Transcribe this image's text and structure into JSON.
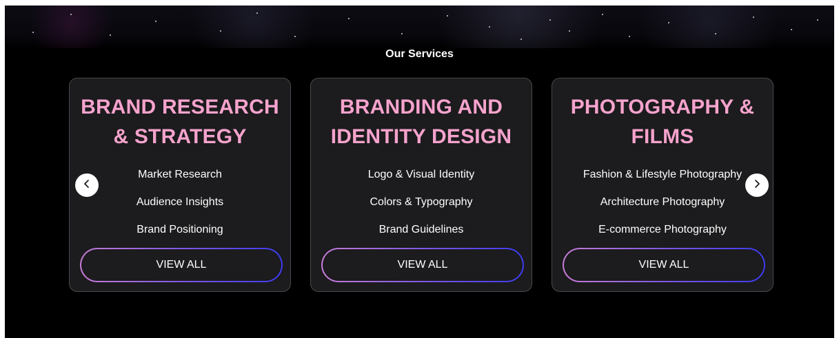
{
  "section": {
    "title": "Our Services"
  },
  "cards": [
    {
      "title_line1": "BRAND RESEARCH",
      "title_line2": "& STRATEGY",
      "items": [
        "Market Research",
        "Audience Insights",
        "Brand Positioning"
      ],
      "button_label": "VIEW ALL"
    },
    {
      "title_line1": "BRANDING AND",
      "title_line2": "IDENTITY DESIGN",
      "items": [
        "Logo & Visual Identity",
        "Colors & Typography",
        "Brand Guidelines"
      ],
      "button_label": "VIEW ALL"
    },
    {
      "title_line1": "PHOTOGRAPHY &",
      "title_line2": "FILMS",
      "items": [
        "Fashion & Lifestyle Photography",
        "Architecture Photography",
        "E-commerce Photography"
      ],
      "button_label": "VIEW ALL"
    }
  ],
  "carousel": {
    "prev_icon": "chevron-left-icon",
    "next_icon": "chevron-right-icon"
  },
  "colors": {
    "background": "#000000",
    "card_background": "#1c1b1d",
    "card_title": "#f6a3cd",
    "button_gradient_start": "#c77dd8",
    "button_gradient_end": "#3b3cf0"
  }
}
